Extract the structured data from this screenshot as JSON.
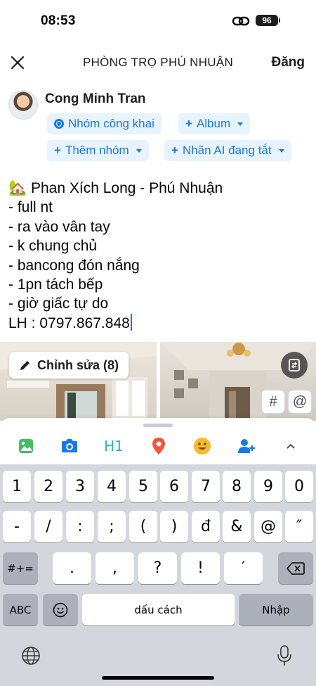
{
  "status_bar": {
    "time": "08:53",
    "battery": "96"
  },
  "header": {
    "title": "PHÒNG TRỌ PHÚ NHUẬN",
    "post_label": "Đăng"
  },
  "author": {
    "name": "Cong Minh Tran"
  },
  "chips": {
    "privacy": "Nhóm công khai",
    "album": "Album",
    "add_group": "Thêm nhóm",
    "ai_label": "Nhãn AI đang tắt"
  },
  "post": {
    "text": "🏡 Phan Xích Long - Phú Nhuận\n- full nt\n- ra vào vân tay\n- k chung chủ\n- bancong đón nắng\n- 1pn tách bếp\n- giờ giấc tự do\nLH : 0797.867.848"
  },
  "photos": {
    "edit_label": "Chỉnh sửa (8)",
    "hashtag": "#",
    "mention": "@"
  },
  "toolbar": {
    "h1": "H1"
  },
  "keyboard": {
    "row1": [
      "1",
      "2",
      "3",
      "4",
      "5",
      "6",
      "7",
      "8",
      "9",
      "0"
    ],
    "row2": [
      "-",
      "/",
      ":",
      ";",
      "(",
      ")",
      "đ",
      "&",
      "@",
      "″"
    ],
    "toggle": "#+=",
    "row3": [
      ".",
      ",",
      "?",
      "!",
      "′"
    ],
    "abc": "ABC",
    "space": "dấu cách",
    "return": "Nhập"
  },
  "colors": {
    "accent": "#1877f2",
    "chip_bg": "#e7f3ff",
    "keyboard_bg": "#d3d6dc"
  }
}
